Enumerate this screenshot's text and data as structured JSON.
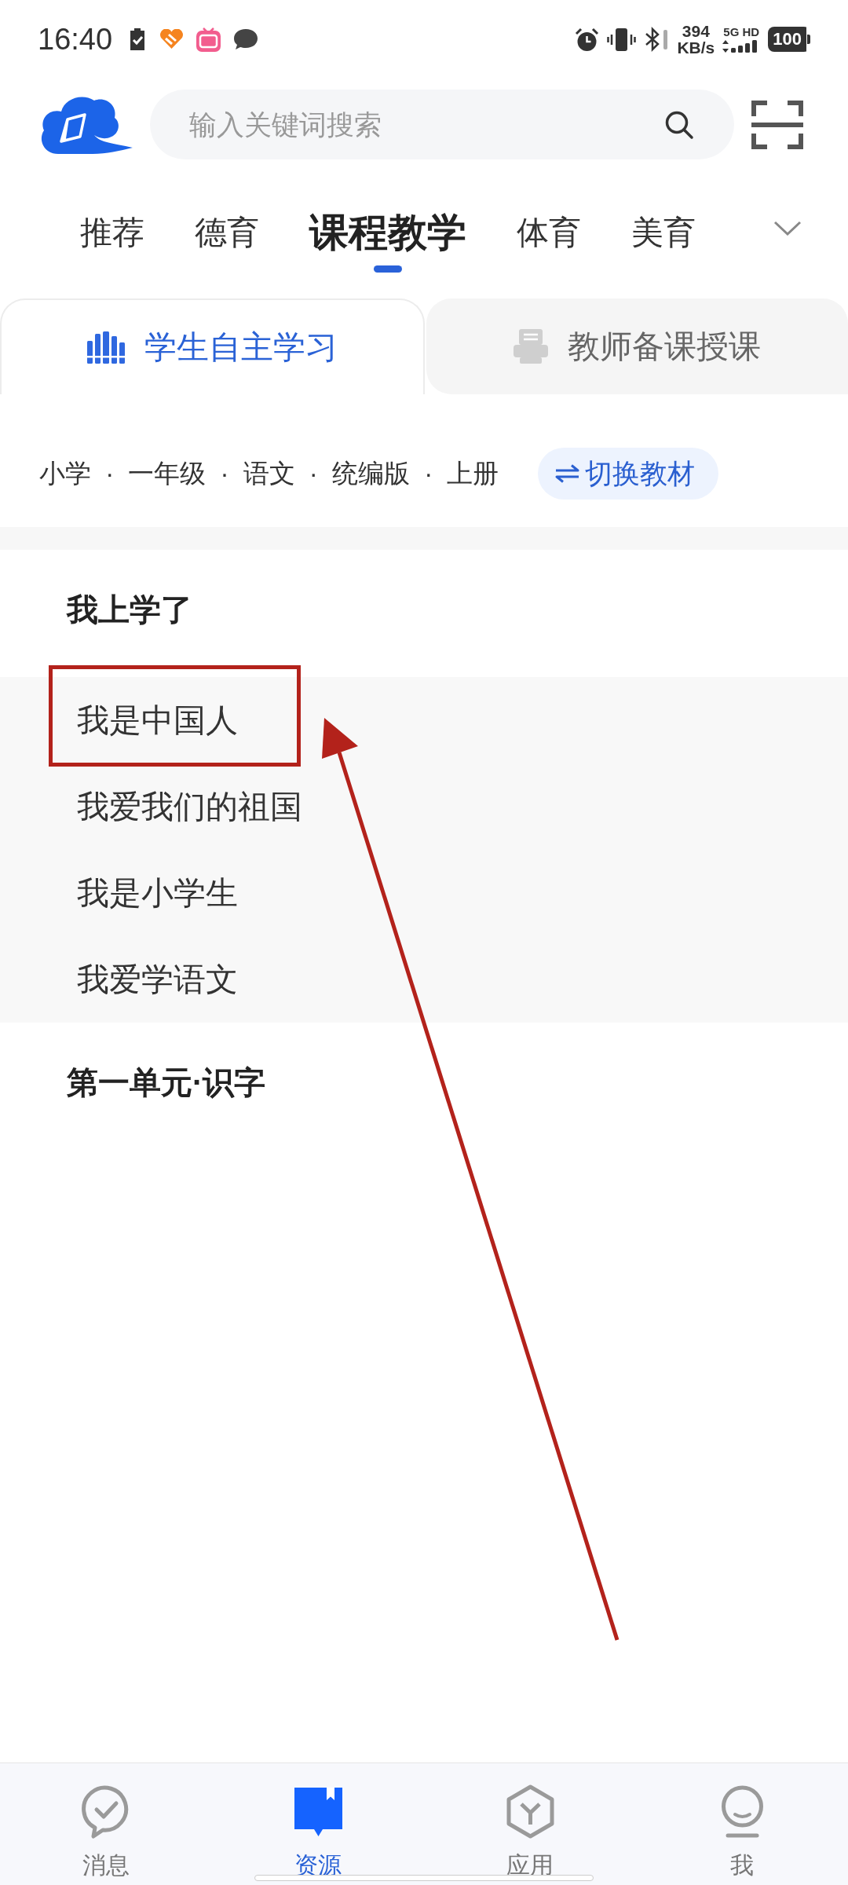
{
  "status_bar": {
    "time": "16:40",
    "net_speed": "394",
    "net_unit": "KB/s",
    "network": "5G HD",
    "battery": "100"
  },
  "header": {
    "search": {
      "placeholder": "输入关键词搜索"
    }
  },
  "categories": [
    {
      "label": "推荐",
      "selected": false
    },
    {
      "label": "德育",
      "selected": false
    },
    {
      "label": "课程教学",
      "selected": true
    },
    {
      "label": "体育",
      "selected": false
    },
    {
      "label": "美育",
      "selected": false
    }
  ],
  "modes": [
    {
      "kind": "student",
      "label": "学生自主学习",
      "selected": true
    },
    {
      "kind": "teacher",
      "label": "教师备课授课",
      "selected": false
    }
  ],
  "textbook": {
    "path": "小学 · 一年级 · 语文 · 统编版 · 上册",
    "switch_button": "切换教材"
  },
  "units": [
    {
      "title": "我上学了",
      "lessons": [
        {
          "title": "我是中国人",
          "highlighted": true
        },
        {
          "title": "我爱我们的祖国",
          "highlighted": false
        },
        {
          "title": "我是小学生",
          "highlighted": false
        },
        {
          "title": "我爱学语文",
          "highlighted": false
        }
      ]
    },
    {
      "title": "第一单元·识字"
    }
  ],
  "annotation": {
    "arrow": true
  },
  "bottom_nav": [
    {
      "kind": "messages",
      "label": "消息",
      "selected": false
    },
    {
      "kind": "resources",
      "label": "资源",
      "selected": true
    },
    {
      "kind": "apps",
      "label": "应用",
      "selected": false
    },
    {
      "kind": "me",
      "label": "我",
      "selected": false
    }
  ]
}
